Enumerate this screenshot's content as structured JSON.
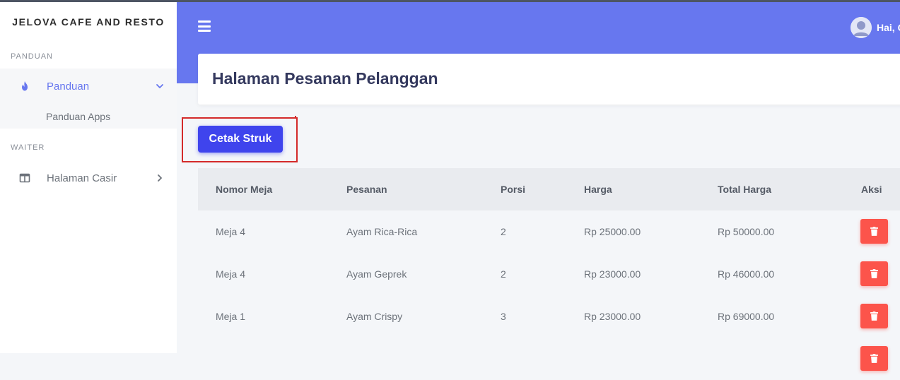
{
  "sidebar": {
    "brand": "JELOVA CAFE AND RESTO",
    "sections": {
      "panduan": "PANDUAN",
      "waiter": "WAITER"
    },
    "items": {
      "panduan": "Panduan",
      "panduan_apps": "Panduan Apps",
      "halaman_casir": "Halaman Casir"
    }
  },
  "header": {
    "user_greeting": "Hai, C"
  },
  "page": {
    "title": "Halaman Pesanan Pelanggan",
    "print_button": "Cetak Struk"
  },
  "table": {
    "columns": [
      "Nomor Meja",
      "Pesanan",
      "Porsi",
      "Harga",
      "Total Harga",
      "Aksi"
    ],
    "rows": [
      {
        "meja": "Meja 4",
        "pesanan": "Ayam Rica-Rica",
        "porsi": "2",
        "harga": "Rp 25000.00",
        "total": "Rp 50000.00"
      },
      {
        "meja": "Meja 4",
        "pesanan": "Ayam Geprek",
        "porsi": "2",
        "harga": "Rp 23000.00",
        "total": "Rp 46000.00"
      },
      {
        "meja": "Meja 1",
        "pesanan": "Ayam Crispy",
        "porsi": "3",
        "harga": "Rp 23000.00",
        "total": "Rp 69000.00"
      },
      {
        "meja": "",
        "pesanan": "",
        "porsi": "",
        "harga": "",
        "total": ""
      }
    ]
  },
  "colors": {
    "primary": "#6777ef",
    "button": "#3f44ed",
    "danger": "#fc544b",
    "highlight": "#d42a2a"
  },
  "icons": {
    "menu": "hamburger-icon",
    "panduan": "fire-icon",
    "casir": "columns-icon",
    "delete": "trash-icon",
    "expand": "chevron-down-icon",
    "collapse": "chevron-right-icon"
  }
}
